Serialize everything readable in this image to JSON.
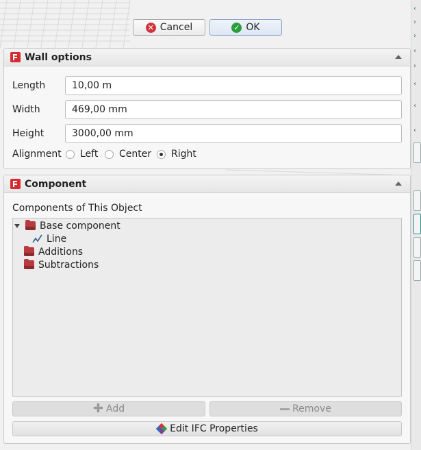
{
  "dialog": {
    "cancel_label": "Cancel",
    "ok_label": "OK"
  },
  "wall_options": {
    "title": "Wall options",
    "length_label": "Length",
    "length_value": "10,00 m",
    "width_label": "Width",
    "width_value": "469,00 mm",
    "height_label": "Height",
    "height_value": "3000,00 mm",
    "alignment_label": "Alignment",
    "alignment_options": [
      "Left",
      "Center",
      "Right"
    ],
    "alignment_selected": "Right"
  },
  "component": {
    "title": "Component",
    "list_label": "Components of This Object",
    "tree": {
      "base": "Base component",
      "base_child": "Line",
      "additions": "Additions",
      "subtractions": "Subtractions"
    },
    "add_label": "Add",
    "remove_label": "Remove",
    "ifc_label": "Edit IFC Properties"
  },
  "colors": {
    "accent_red": "#d2343d",
    "ok_green": "#2a9d3a",
    "folder_red": "#b83a3e"
  }
}
